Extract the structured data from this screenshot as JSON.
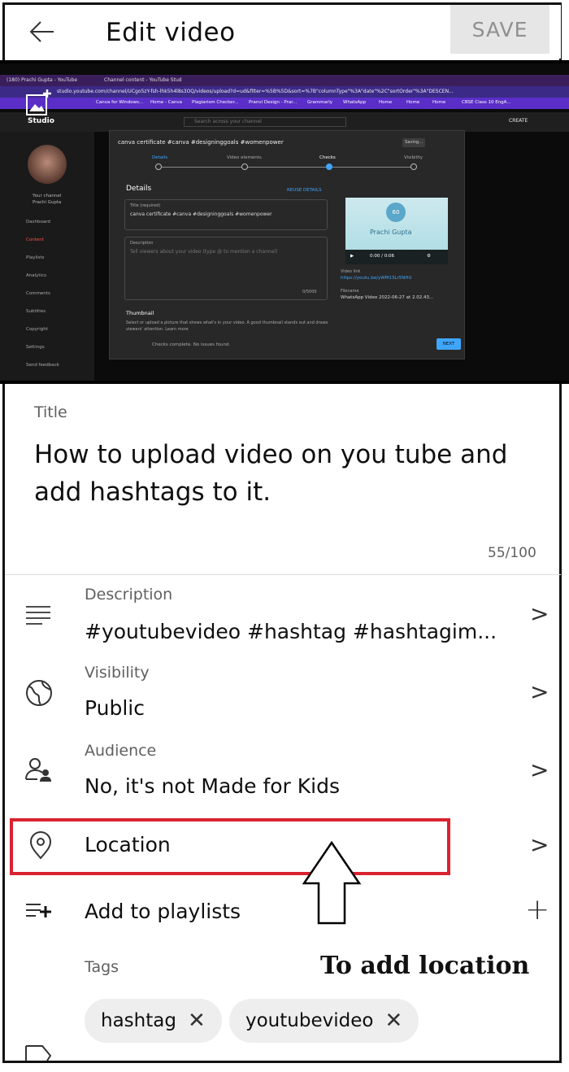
{
  "header": {
    "back_icon": "arrow-left-icon",
    "title": "Edit video",
    "save_label": "SAVE"
  },
  "preview": {
    "browser_tab_1": "(180) Prachi Gupta - YouTube",
    "browser_tab_2": "Channel content - YouTube Stud",
    "url": "studio.youtube.com/channel/UCgo5zY-fsh-lhk5h4l8s3OQ/videos/upload?d=ud&filter=%5B%5D&sort=%7B\"columnType\"%3A\"date\"%2C\"sortOrder\"%3A\"DESCEN...",
    "bookmarks": [
      "Canva for Windows...",
      "Home - Canva",
      "Plagiarism Checker...",
      "Pranvi Design - Prar...",
      "Grammarly",
      "WhatsApp",
      "Home",
      "Home",
      "Home",
      "CBSE Class 10 EngA..."
    ],
    "studio_logo": "Studio",
    "search_placeholder": "Search across your channel",
    "create_label": "CREATE",
    "your_channel": "Your channel",
    "channel_name": "Prachi Gupta",
    "sidebar": [
      "Dashboard",
      "Content",
      "Playlists",
      "Analytics",
      "Comments",
      "Subtitles",
      "Copyright",
      "Settings",
      "Send feedback"
    ],
    "modal_title": "canva certificate #canva #designinggoals #womenpower",
    "saving": "Saving...",
    "steps": [
      "Details",
      "Video elements",
      "Checks",
      "Visibility"
    ],
    "details_heading": "Details",
    "reuse_details": "REUSE DETAILS",
    "title_field_label": "Title (required)",
    "title_field_value": "canva certificate #canva #designinggoals #womenpower",
    "description_label": "Description",
    "description_placeholder": "Tell viewers about your video (type @ to mention a channel)",
    "desc_counter": "0/5000",
    "thumb_name": "Prachi Gupta",
    "badge": "60",
    "player_time": "0:00 / 0:06",
    "video_link_label": "Video link",
    "video_link": "https://youtu.be/yWM13Lr5NHU",
    "filename_label": "Filename",
    "filename": "WhatsApp Video 2022-06-27 at 2.02.43...",
    "thumbnail_heading": "Thumbnail",
    "thumbnail_desc": "Select or upload a picture that shows what's in your video. A good thumbnail stands out and draws viewers' attention. Learn more",
    "checks_status": "Checks complete. No issues found.",
    "next_label": "NEXT"
  },
  "title_section": {
    "label": "Title",
    "value": "How to upload video on you tube and add hashtags to it.",
    "counter": "55/100"
  },
  "rows": {
    "description": {
      "label": "Description",
      "value": "#youtubevideo  #hashtag #hashtagim...",
      "icon": "text-lines-icon"
    },
    "visibility": {
      "label": "Visibility",
      "value": "Public",
      "icon": "globe-icon"
    },
    "audience": {
      "label": "Audience",
      "value": "No, it's not Made for Kids",
      "icon": "people-icon"
    },
    "location": {
      "value": "Location",
      "icon": "location-pin-icon"
    },
    "playlists": {
      "value": "Add to playlists",
      "icon": "playlist-add-icon"
    }
  },
  "tags": {
    "label": "Tags",
    "items": [
      "hashtag",
      "youtubevideo"
    ]
  },
  "annotation": {
    "text": "To add location",
    "highlight_color": "#d9232f"
  },
  "colors": {
    "accent_blue": "#3ea6ff",
    "save_bg": "#e6e6e6",
    "chip_bg": "#eeeeee"
  }
}
